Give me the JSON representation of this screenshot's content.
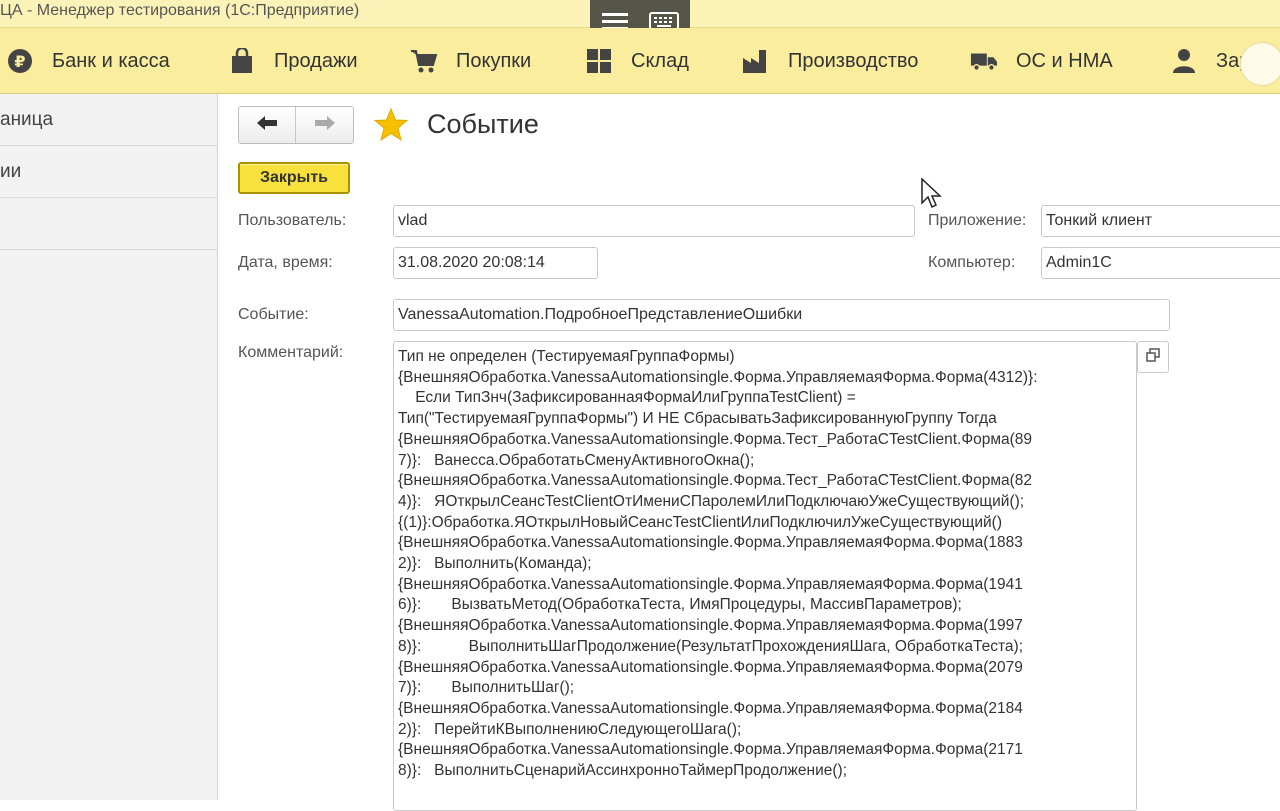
{
  "window": {
    "title": "ЦА  - Менеджер тестирования (1С:Предприятие)"
  },
  "overlay": {
    "menu_icon": "hamburger-icon",
    "keyboard_icon": "keyboard-icon"
  },
  "sections": [
    {
      "label": "Банк и касса",
      "icon": "ruble-icon"
    },
    {
      "label": "Продажи",
      "icon": "shopping-bag-icon"
    },
    {
      "label": "Покупки",
      "icon": "cart-icon"
    },
    {
      "label": "Склад",
      "icon": "grid-icon"
    },
    {
      "label": "Производство",
      "icon": "factory-icon"
    },
    {
      "label": "ОС и НМА",
      "icon": "truck-icon"
    },
    {
      "label": "Зарпла",
      "icon": "person-icon"
    }
  ],
  "left_panel": {
    "items": [
      "аница",
      "ии",
      ""
    ]
  },
  "form": {
    "title": "Событие",
    "close_label": "Закрыть",
    "user_label": "Пользователь:",
    "user_value": "vlad",
    "app_label": "Приложение:",
    "app_value": "Тонкий клиент",
    "datetime_label": "Дата, время:",
    "datetime_value": "31.08.2020 20:08:14",
    "computer_label": "Компьютер:",
    "computer_value": "Admin1C",
    "event_label": "Событие:",
    "event_value": "VanessaAutomation.ПодробноеПредставлениеОшибки",
    "comment_label": "Комментарий:",
    "comment_lines": [
      "Тип не определен (ТестируемаяГруппаФормы)",
      "{ВнешняяОбработка.VanessaAutomationsingle.Форма.УправляемаяФорма.Форма(4312)}:",
      "    Если ТипЗнч(ЗафиксированнаяФормаИлиГруппаTestClient) =",
      "Тип(\"ТестируемаяГруппаФормы\") И НЕ СбрасыватьЗафиксированнуюГруппу Тогда",
      "{ВнешняяОбработка.VanessaAutomationsingle.Форма.Тест_РаботаСTestClient.Форма(89",
      "7)}:   Ванесса.ОбработатьСменуАктивногоОкна();",
      "{ВнешняяОбработка.VanessaAutomationsingle.Форма.Тест_РаботаСTestClient.Форма(82",
      "4)}:   ЯОткрылСеансTestClientОтИмениСПаролемИлиПодключаюУжеСуществующий();",
      "{(1)}:Обработка.ЯОткрылНовыйСеансTestClientИлиПодключилУжеСуществующий()",
      "{ВнешняяОбработка.VanessaAutomationsingle.Форма.УправляемаяФорма.Форма(1883",
      "2)}:   Выполнить(Команда);",
      "{ВнешняяОбработка.VanessaAutomationsingle.Форма.УправляемаяФорма.Форма(1941",
      "6)}:       ВызватьМетод(ОбработкаТеста, ИмяПроцедуры, МассивПараметров);",
      "{ВнешняяОбработка.VanessaAutomationsingle.Форма.УправляемаяФорма.Форма(1997",
      "8)}:           ВыполнитьШагПродолжение(РезультатПрохожденияШага, ОбработкаТеста);",
      "{ВнешняяОбработка.VanessaAutomationsingle.Форма.УправляемаяФорма.Форма(2079",
      "7)}:       ВыполнитьШаг();",
      "{ВнешняяОбработка.VanessaAutomationsingle.Форма.УправляемаяФорма.Форма(2184",
      "2)}:   ПерейтиКВыполнениюСледующегоШага();",
      "{ВнешняяОбработка.VanessaAutomationsingle.Форма.УправляемаяФорма.Форма(2171",
      "8)}:   ВыполнитьСценарийАссинхронноТаймерПродолжение();"
    ]
  },
  "colors": {
    "titlebar": "#fbf2b8",
    "sections_bar": "#fbed9e",
    "close_button": "#f8e13d",
    "star": "#f6c000"
  }
}
